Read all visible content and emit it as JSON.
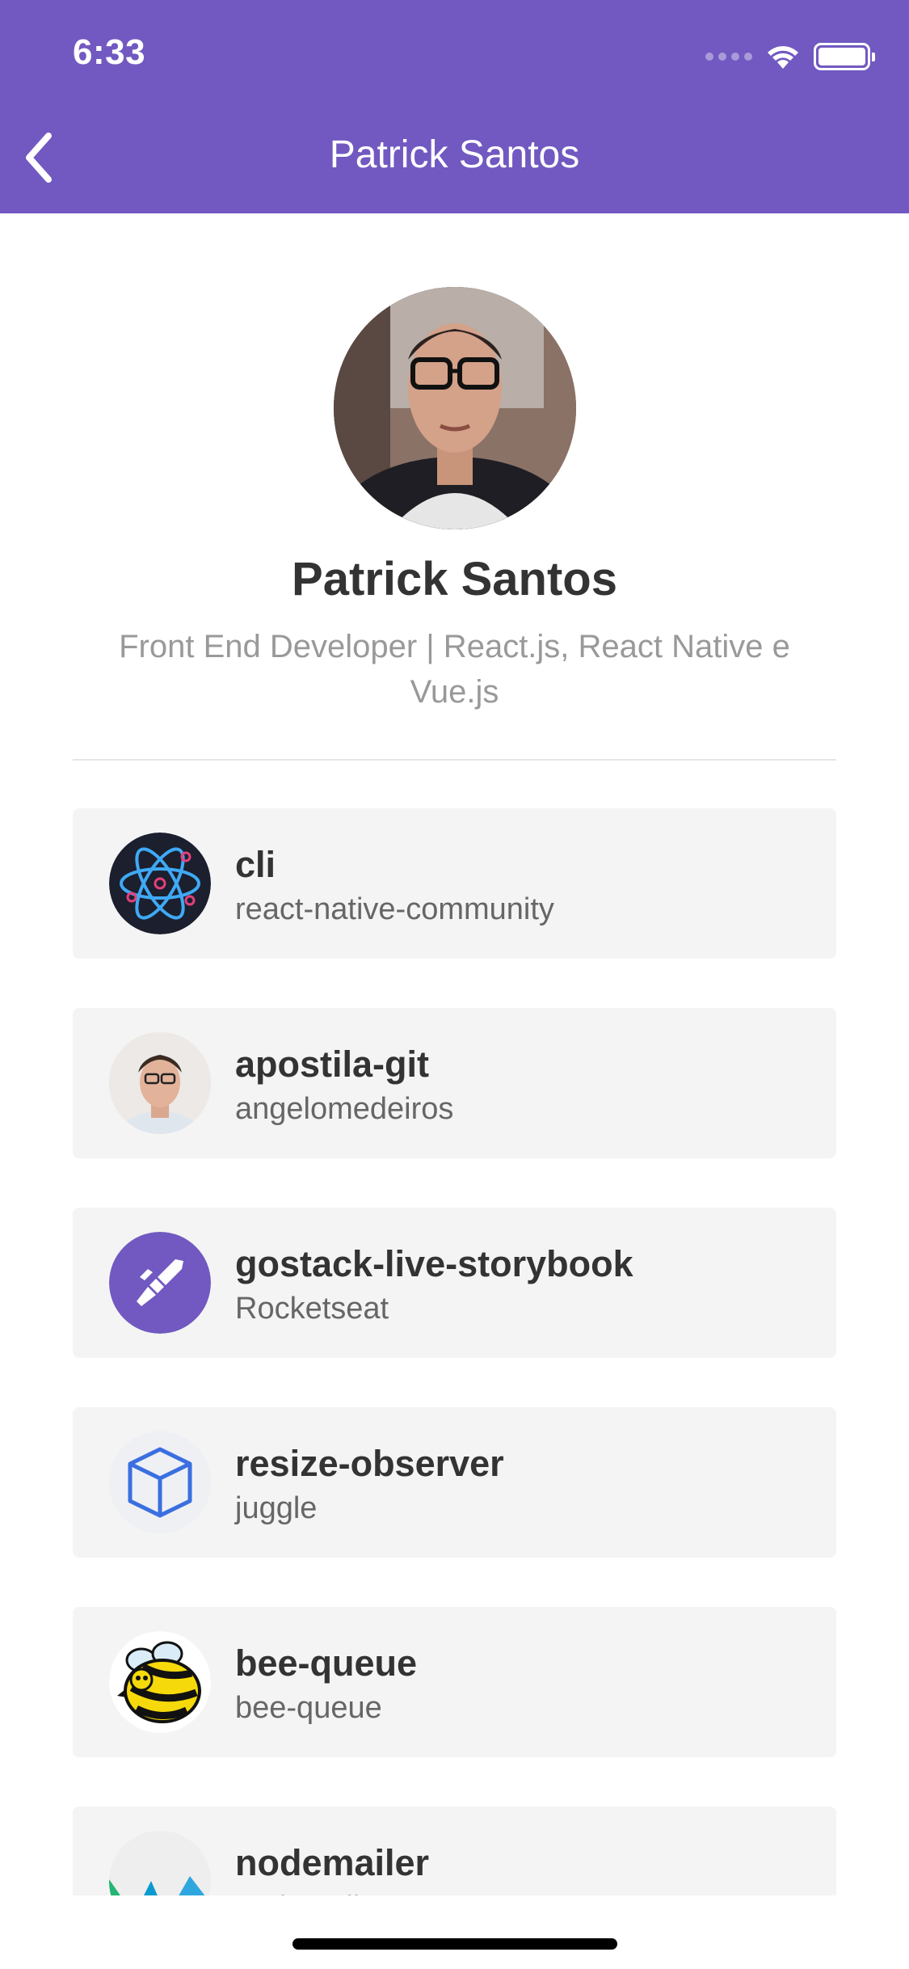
{
  "status_bar": {
    "time": "6:33"
  },
  "nav": {
    "title": "Patrick Santos",
    "back_icon": "chevron-left-icon"
  },
  "profile": {
    "name": "Patrick Santos",
    "bio": "Front End Developer | React.js, React Native e Vue.js"
  },
  "repos": [
    {
      "name": "cli",
      "owner": "react-native-community",
      "icon": "react-atom-icon"
    },
    {
      "name": "apostila-git",
      "owner": "angelomedeiros",
      "icon": "user-avatar"
    },
    {
      "name": "gostack-live-storybook",
      "owner": "Rocketseat",
      "icon": "rocketseat-logo"
    },
    {
      "name": "resize-observer",
      "owner": "juggle",
      "icon": "cube-icon"
    },
    {
      "name": "bee-queue",
      "owner": "bee-queue",
      "icon": "bee-logo"
    },
    {
      "name": "nodemailer",
      "owner": "nodemailer",
      "icon": "nodemailer-logo"
    }
  ],
  "colors": {
    "header": "#7159c1",
    "card": "#f4f4f4",
    "title_text": "#333333",
    "subtitle_text": "#666666",
    "bio_text": "#999999"
  }
}
